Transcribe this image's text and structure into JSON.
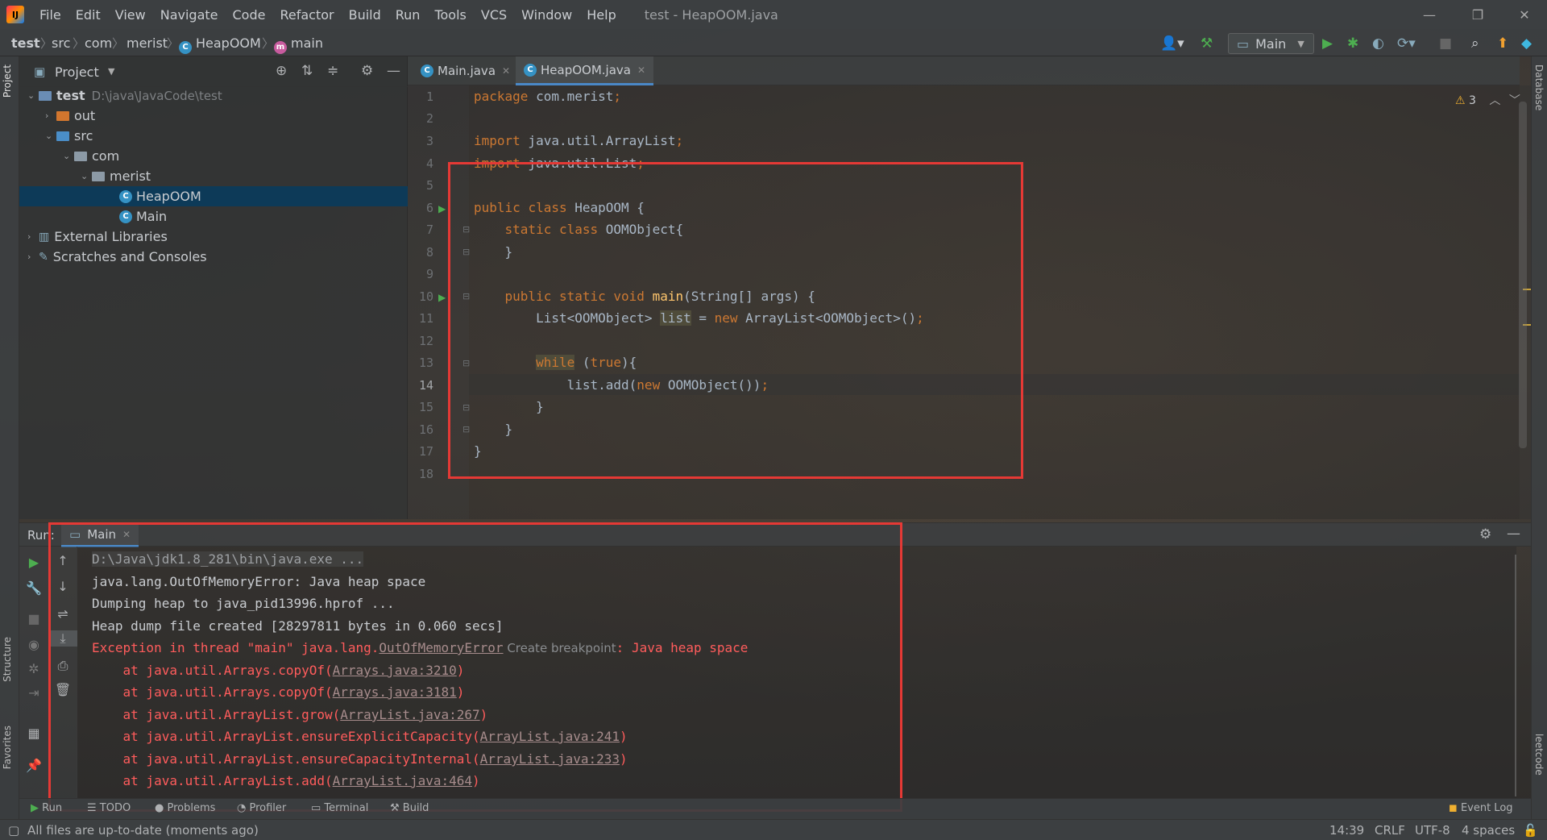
{
  "window": {
    "title": "test - HeapOOM.java",
    "menu": [
      "File",
      "Edit",
      "View",
      "Navigate",
      "Code",
      "Refactor",
      "Build",
      "Run",
      "Tools",
      "VCS",
      "Window",
      "Help"
    ]
  },
  "breadcrumb": [
    "test",
    "src",
    "com",
    "merist",
    "HeapOOM",
    "main"
  ],
  "run_config": "Main",
  "project_panel": {
    "title": "Project",
    "tree": [
      {
        "label": "test",
        "extra": "D:\\java\\JavaCode\\test",
        "kind": "module"
      },
      {
        "label": "out",
        "kind": "folder-orange"
      },
      {
        "label": "src",
        "kind": "folder-blue"
      },
      {
        "label": "com",
        "kind": "package"
      },
      {
        "label": "merist",
        "kind": "package"
      },
      {
        "label": "HeapOOM",
        "kind": "class",
        "selected": true
      },
      {
        "label": "Main",
        "kind": "class"
      },
      {
        "label": "External Libraries",
        "kind": "libs"
      },
      {
        "label": "Scratches and Consoles",
        "kind": "scratch"
      }
    ]
  },
  "editor": {
    "tabs": [
      {
        "label": "Main.java",
        "active": false
      },
      {
        "label": "HeapOOM.java",
        "active": true
      }
    ],
    "warnings": "3",
    "current_line": 14,
    "lines": [
      "package com.merist;",
      "",
      "import java.util.ArrayList;",
      "import java.util.List;",
      "",
      "public class HeapOOM {",
      "    static class OOMObject{",
      "    }",
      "",
      "    public static void main(String[] args) {",
      "        List<OOMObject> list = new ArrayList<OOMObject>();",
      "",
      "        while (true){",
      "            list.add(new OOMObject());",
      "        }",
      "    }",
      "}",
      ""
    ]
  },
  "run_panel": {
    "label": "Run:",
    "tab": "Main",
    "console": {
      "cmd": "D:\\Java\\jdk1.8_281\\bin\\java.exe ...",
      "l1": "java.lang.OutOfMemoryError: Java heap space",
      "l2": "Dumping heap to java_pid13996.hprof ...",
      "l3": "Heap dump file created [28297811 bytes in 0.060 secs]",
      "exc_prefix": "Exception in thread \"main\" java.lang.",
      "exc_link": "OutOfMemoryError",
      "exc_hint": "Create breakpoint",
      "exc_suffix": ": Java heap space",
      "stack": [
        {
          "at": "    at java.util.Arrays.copyOf(",
          "link": "Arrays.java:3210",
          "end": ")"
        },
        {
          "at": "    at java.util.Arrays.copyOf(",
          "link": "Arrays.java:3181",
          "end": ")"
        },
        {
          "at": "    at java.util.ArrayList.grow(",
          "link": "ArrayList.java:267",
          "end": ")"
        },
        {
          "at": "    at java.util.ArrayList.ensureExplicitCapacity(",
          "link": "ArrayList.java:241",
          "end": ")"
        },
        {
          "at": "    at java.util.ArrayList.ensureCapacityInternal(",
          "link": "ArrayList.java:233",
          "end": ")"
        },
        {
          "at": "    at java.util.ArrayList.add(",
          "link": "ArrayList.java:464",
          "end": ")"
        }
      ]
    }
  },
  "tool_tabs": [
    "Run",
    "TODO",
    "Problems",
    "Profiler",
    "Terminal",
    "Build"
  ],
  "event_log": "Event Log",
  "side_labels": {
    "project": "Project",
    "structure": "Structure",
    "favorites": "Favorites",
    "database": "Database",
    "leetcode": "leetcode"
  },
  "status": {
    "message": "All files are up-to-date (moments ago)",
    "position": "14:39",
    "line_sep": "CRLF",
    "encoding": "UTF-8",
    "indent": "4 spaces"
  }
}
